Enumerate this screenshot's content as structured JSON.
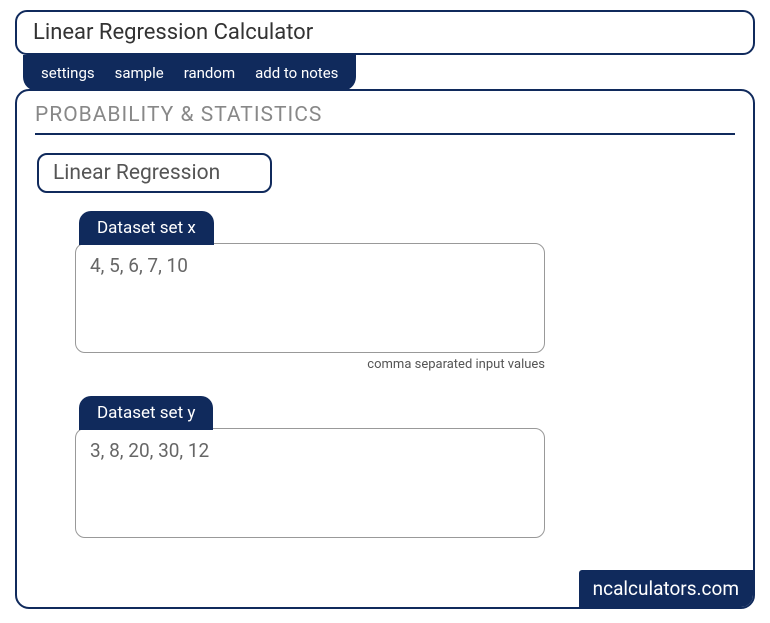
{
  "title": "Linear Regression Calculator",
  "toolbar": {
    "settings": "settings",
    "sample": "sample",
    "random": "random",
    "add_to_notes": "add to notes"
  },
  "section_heading": "PROBABILITY & STATISTICS",
  "sub_heading": "Linear Regression",
  "dataset_x": {
    "label": "Dataset set x",
    "value": "4, 5, 6, 7, 10",
    "helper": "comma separated input values"
  },
  "dataset_y": {
    "label": "Dataset set y",
    "value": "3, 8, 20, 30, 12"
  },
  "watermark": "ncalculators.com"
}
